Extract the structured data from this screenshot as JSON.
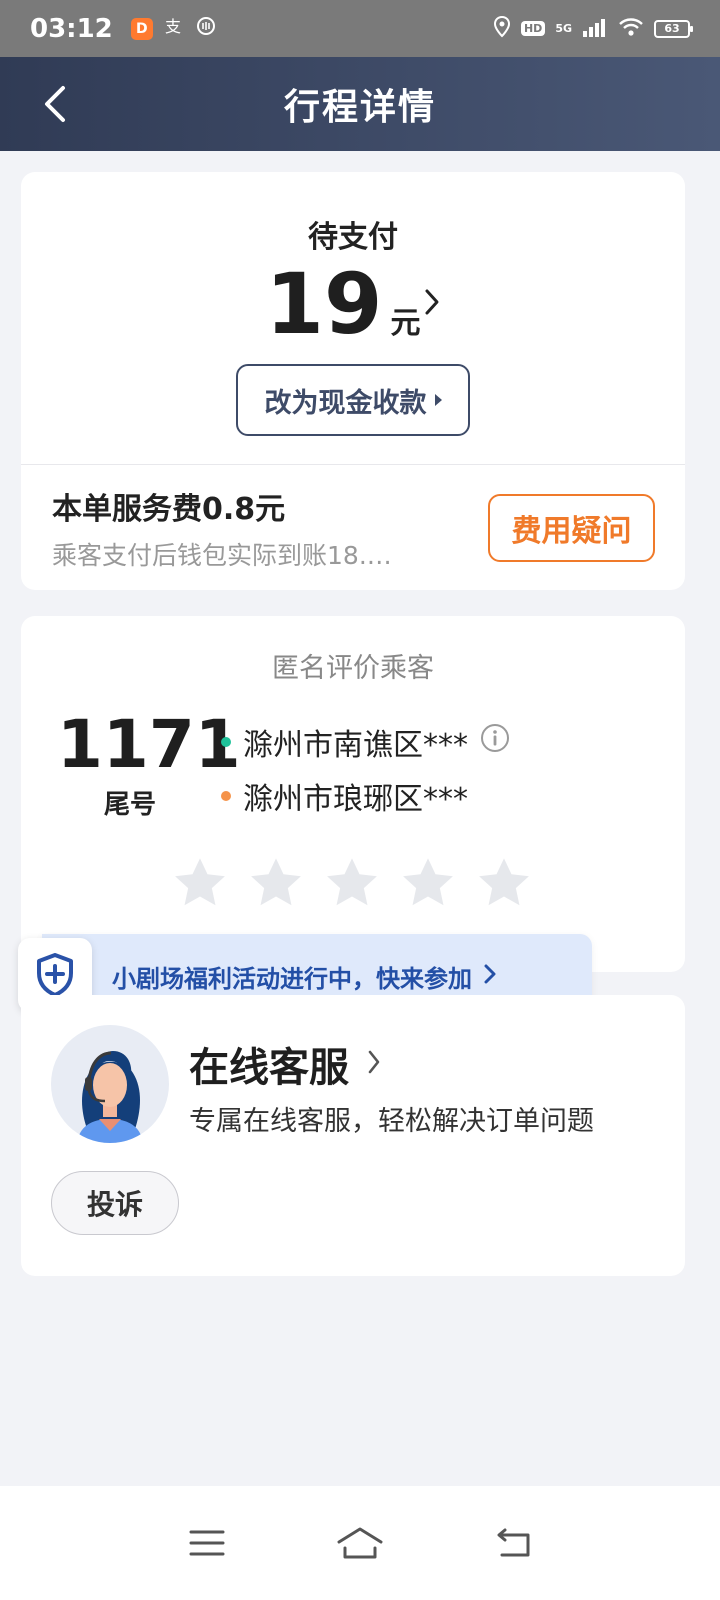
{
  "status_bar": {
    "time": "03:12",
    "app_icon_char": "D",
    "left_icons": [
      "didi-app-icon",
      "alipay-icon",
      "wallet-icon"
    ],
    "hd_label": "HD",
    "network_label": "5G",
    "battery": "63"
  },
  "header": {
    "title": "行程详情"
  },
  "payment": {
    "status": "待支付",
    "amount": "19",
    "unit": "元",
    "cash_button": "改为现金收款",
    "service_fee": "本单服务费0.8元",
    "service_sub": "乘客支付后钱包实际到账18.…",
    "fee_question": "费用疑问"
  },
  "rating": {
    "title": "匿名评价乘客",
    "tail_number": "1171",
    "tail_label": "尾号",
    "route_from": "滁州市南谯区***",
    "route_to": "滁州市琅琊区***",
    "stars_total": 5,
    "stars_selected": 0
  },
  "promo": {
    "text": "小剧场福利活动进行中，快来参加"
  },
  "service": {
    "title": "在线客服",
    "desc": "专属在线客服，轻松解决订单问题",
    "complain": "投诉"
  },
  "colors": {
    "header_start": "#303b55",
    "header_end": "#4a5876",
    "accent_orange": "#f07a2a",
    "promo_blue": "#234fa6",
    "green_dot": "#1fc29a",
    "orange_dot": "#f5934a"
  }
}
